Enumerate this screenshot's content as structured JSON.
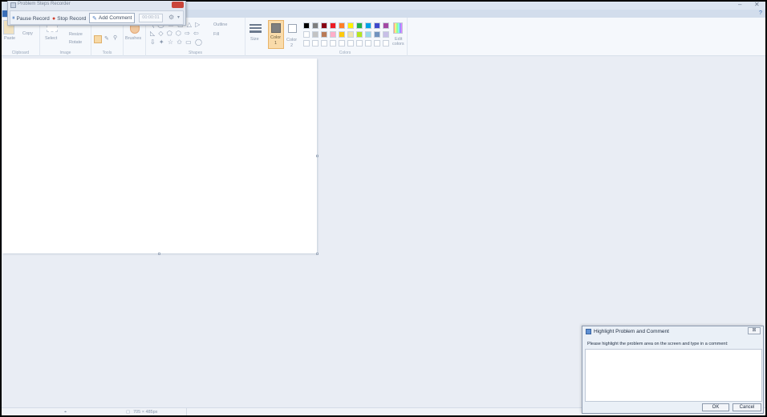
{
  "ribbon": {
    "clipboard": {
      "paste": "Paste",
      "copy": "Copy",
      "label": "Clipboard"
    },
    "image": {
      "select": "Select",
      "resize": "Resize",
      "rotate": "Rotate",
      "label": "Image"
    },
    "tools": {
      "label": "Tools"
    },
    "brushes": {
      "label": "Brushes"
    },
    "shapes": {
      "outline": "Outline",
      "fill": "Fill",
      "label": "Shapes"
    },
    "size": {
      "label": "Size"
    },
    "color1": {
      "label": "Color",
      "num": "1"
    },
    "color2": {
      "label": "Color",
      "num": "2"
    },
    "colors": {
      "label": "Colors",
      "edit": "Edit",
      "edit2": "colors"
    },
    "palette_row1": [
      "#000000",
      "#7f7f7f",
      "#880015",
      "#ed1c24",
      "#ff7f27",
      "#fff200",
      "#22b14c",
      "#00a2e8",
      "#3f48cc",
      "#a349a4"
    ],
    "palette_row2": [
      "#ffffff",
      "#c3c3c3",
      "#b97a57",
      "#ffaec9",
      "#ffc90e",
      "#efe4b0",
      "#b5e61d",
      "#99d9ea",
      "#7092be",
      "#c8bfe7"
    ]
  },
  "status": {
    "dimensions": "705 × 485px"
  },
  "psr": {
    "title": "Problem Steps Recorder",
    "pause": "Pause Record",
    "stop": "Stop Record",
    "comment": "Add Comment",
    "timer": "00:00:01"
  },
  "dialog": {
    "title": "Highlight Problem and Comment",
    "prompt": "Please highlight the problem area on the screen and type in a comment:",
    "ok": "OK",
    "cancel": "Cancel"
  }
}
